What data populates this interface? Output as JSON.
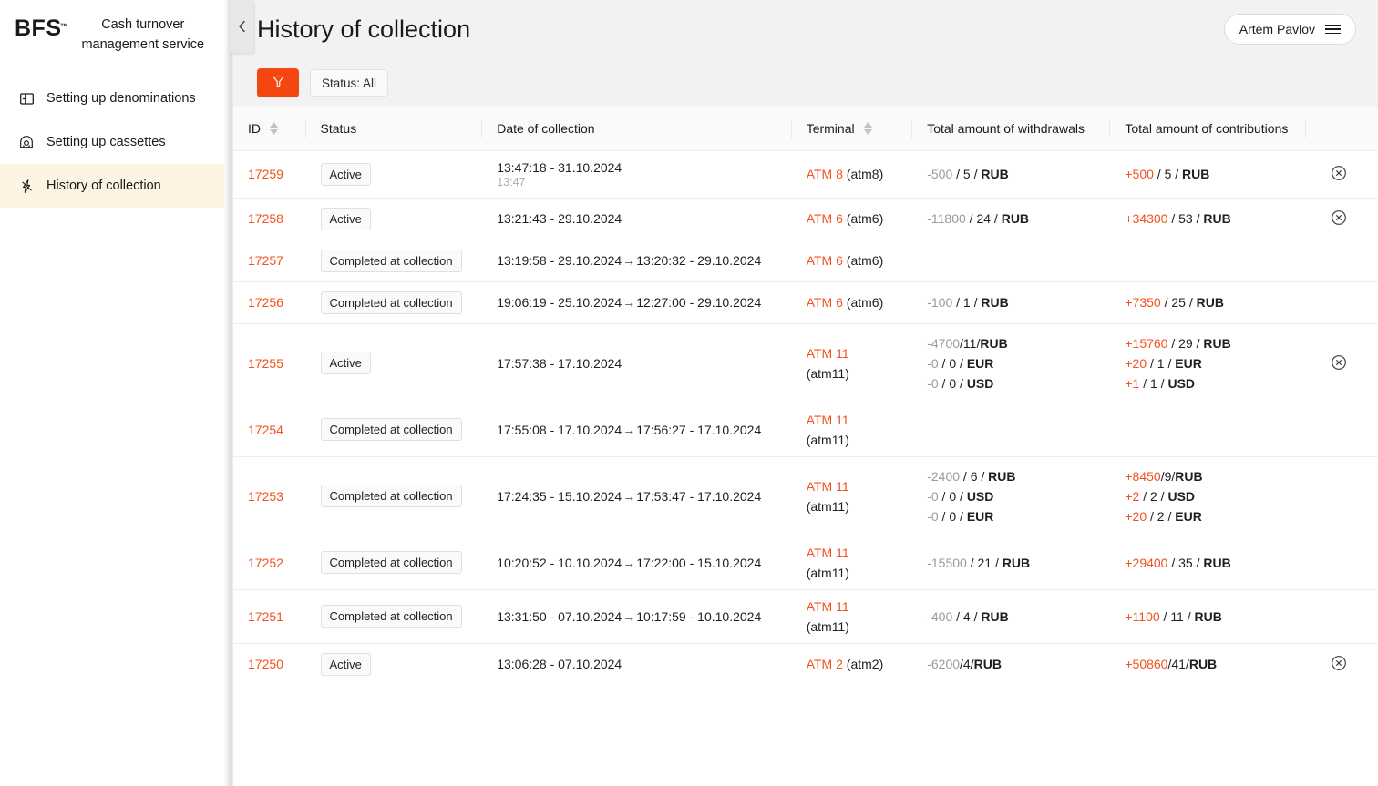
{
  "sidebar": {
    "logo": "BFS",
    "logo_tm": "™",
    "brand_title": "Cash turnover management service",
    "collapse_icon": "chevron-left-icon",
    "items": [
      {
        "label": "Setting up denominations",
        "icon": "panel-left-icon",
        "active": false
      },
      {
        "label": "Setting up cassettes",
        "icon": "cassette-icon",
        "active": false
      },
      {
        "label": "History of collection",
        "icon": "lightning-icon",
        "active": true
      }
    ]
  },
  "header": {
    "title": "History of collection",
    "user_name": "Artem Pavlov",
    "menu_icon": "hamburger-icon"
  },
  "filters": {
    "filter_icon": "funnel-icon",
    "filter_button_color": "#f44611",
    "status_chip": "Status: All"
  },
  "table": {
    "columns": [
      {
        "key": "id",
        "label": "ID",
        "sortable": true
      },
      {
        "key": "status",
        "label": "Status",
        "sortable": false
      },
      {
        "key": "date",
        "label": "Date of collection",
        "sortable": false
      },
      {
        "key": "terminal",
        "label": "Terminal",
        "sortable": true
      },
      {
        "key": "withdrawals",
        "label": "Total amount of withdrawals",
        "sortable": false
      },
      {
        "key": "contributions",
        "label": "Total amount of contributions",
        "sortable": false
      },
      {
        "key": "actions",
        "label": "",
        "sortable": false
      }
    ],
    "rows": [
      {
        "id": "17259",
        "status": "Active",
        "date_main": "13:47:18 - 31.10.2024",
        "date_sub": "13:47",
        "date_end": "",
        "terminal_name": "ATM 8",
        "terminal_code": "(atm8)",
        "terminal_stacked": false,
        "withdrawals": [
          {
            "amount": "-500",
            "count": "5",
            "currency": "RUB",
            "compact": false
          }
        ],
        "contributions": [
          {
            "amount": "+500",
            "count": "5",
            "currency": "RUB",
            "compact": false
          }
        ],
        "cancellable": true
      },
      {
        "id": "17258",
        "status": "Active",
        "date_main": "13:21:43 - 29.10.2024",
        "date_sub": "",
        "date_end": "",
        "terminal_name": "ATM 6",
        "terminal_code": "(atm6)",
        "terminal_stacked": false,
        "withdrawals": [
          {
            "amount": "-11800",
            "count": "24",
            "currency": "RUB",
            "compact": false
          }
        ],
        "contributions": [
          {
            "amount": "+34300",
            "count": "53",
            "currency": "RUB",
            "compact": false
          }
        ],
        "cancellable": true
      },
      {
        "id": "17257",
        "status": "Completed at collection",
        "date_main": "13:19:58 - 29.10.2024",
        "date_sub": "",
        "date_end": "13:20:32 - 29.10.2024",
        "terminal_name": "ATM 6",
        "terminal_code": "(atm6)",
        "terminal_stacked": false,
        "withdrawals": [],
        "contributions": [],
        "cancellable": false
      },
      {
        "id": "17256",
        "status": "Completed at collection",
        "date_main": "19:06:19 - 25.10.2024",
        "date_sub": "",
        "date_end": "12:27:00 - 29.10.2024",
        "terminal_name": "ATM 6",
        "terminal_code": "(atm6)",
        "terminal_stacked": false,
        "withdrawals": [
          {
            "amount": "-100",
            "count": "1",
            "currency": "RUB",
            "compact": false
          }
        ],
        "contributions": [
          {
            "amount": "+7350",
            "count": "25",
            "currency": "RUB",
            "compact": false
          }
        ],
        "cancellable": false
      },
      {
        "id": "17255",
        "status": "Active",
        "date_main": "17:57:38 - 17.10.2024",
        "date_sub": "",
        "date_end": "",
        "terminal_name": "ATM 11",
        "terminal_code": "(atm11)",
        "terminal_stacked": true,
        "withdrawals": [
          {
            "amount": "-4700",
            "count": "11",
            "currency": "RUB",
            "compact": true
          },
          {
            "amount": "-0",
            "count": "0",
            "currency": "EUR",
            "compact": false
          },
          {
            "amount": "-0",
            "count": "0",
            "currency": "USD",
            "compact": false
          }
        ],
        "contributions": [
          {
            "amount": "+15760",
            "count": "29",
            "currency": "RUB",
            "compact": false
          },
          {
            "amount": "+20",
            "count": "1",
            "currency": "EUR",
            "compact": false
          },
          {
            "amount": "+1",
            "count": "1",
            "currency": "USD",
            "compact": false
          }
        ],
        "cancellable": true
      },
      {
        "id": "17254",
        "status": "Completed at collection",
        "date_main": "17:55:08 - 17.10.2024",
        "date_sub": "",
        "date_end": "17:56:27 - 17.10.2024",
        "terminal_name": "ATM 11",
        "terminal_code": "(atm11)",
        "terminal_stacked": true,
        "withdrawals": [],
        "contributions": [],
        "cancellable": false
      },
      {
        "id": "17253",
        "status": "Completed at collection",
        "date_main": "17:24:35 - 15.10.2024",
        "date_sub": "",
        "date_end": "17:53:47 - 17.10.2024",
        "terminal_name": "ATM 11",
        "terminal_code": "(atm11)",
        "terminal_stacked": true,
        "withdrawals": [
          {
            "amount": "-2400",
            "count": "6",
            "currency": "RUB",
            "compact": false
          },
          {
            "amount": "-0",
            "count": "0",
            "currency": "USD",
            "compact": false
          },
          {
            "amount": "-0",
            "count": "0",
            "currency": "EUR",
            "compact": false
          }
        ],
        "contributions": [
          {
            "amount": "+8450",
            "count": "9",
            "currency": "RUB",
            "compact": true
          },
          {
            "amount": "+2",
            "count": "2",
            "currency": "USD",
            "compact": false
          },
          {
            "amount": "+20",
            "count": "2",
            "currency": "EUR",
            "compact": false
          }
        ],
        "cancellable": false
      },
      {
        "id": "17252",
        "status": "Completed at collection",
        "date_main": "10:20:52 - 10.10.2024",
        "date_sub": "",
        "date_end": "17:22:00 - 15.10.2024",
        "terminal_name": "ATM 11",
        "terminal_code": "(atm11)",
        "terminal_stacked": true,
        "withdrawals": [
          {
            "amount": "-15500",
            "count": "21",
            "currency": "RUB",
            "compact": false
          }
        ],
        "contributions": [
          {
            "amount": "+29400",
            "count": "35",
            "currency": "RUB",
            "compact": false
          }
        ],
        "cancellable": false
      },
      {
        "id": "17251",
        "status": "Completed at collection",
        "date_main": "13:31:50 - 07.10.2024",
        "date_sub": "",
        "date_end": "10:17:59 - 10.10.2024",
        "terminal_name": "ATM 11",
        "terminal_code": "(atm11)",
        "terminal_stacked": true,
        "withdrawals": [
          {
            "amount": "-400",
            "count": "4",
            "currency": "RUB",
            "compact": false
          }
        ],
        "contributions": [
          {
            "amount": "+1100",
            "count": "11",
            "currency": "RUB",
            "compact": false
          }
        ],
        "cancellable": false
      },
      {
        "id": "17250",
        "status": "Active",
        "date_main": "13:06:28 - 07.10.2024",
        "date_sub": "",
        "date_end": "",
        "terminal_name": "ATM 2",
        "terminal_code": "(atm2)",
        "terminal_stacked": false,
        "withdrawals": [
          {
            "amount": "-6200",
            "count": "4",
            "currency": "RUB",
            "compact": true
          }
        ],
        "contributions": [
          {
            "amount": "+50860",
            "count": "41",
            "currency": "RUB",
            "compact": true
          }
        ],
        "cancellable": true
      }
    ],
    "arrow_glyph": "→",
    "cancel_icon": "cancel-circle-icon"
  },
  "colors": {
    "accent": "#f4511e",
    "filter_orange": "#f44611",
    "active_nav_bg": "#fdf3e3",
    "muted": "#9a9a9a"
  }
}
